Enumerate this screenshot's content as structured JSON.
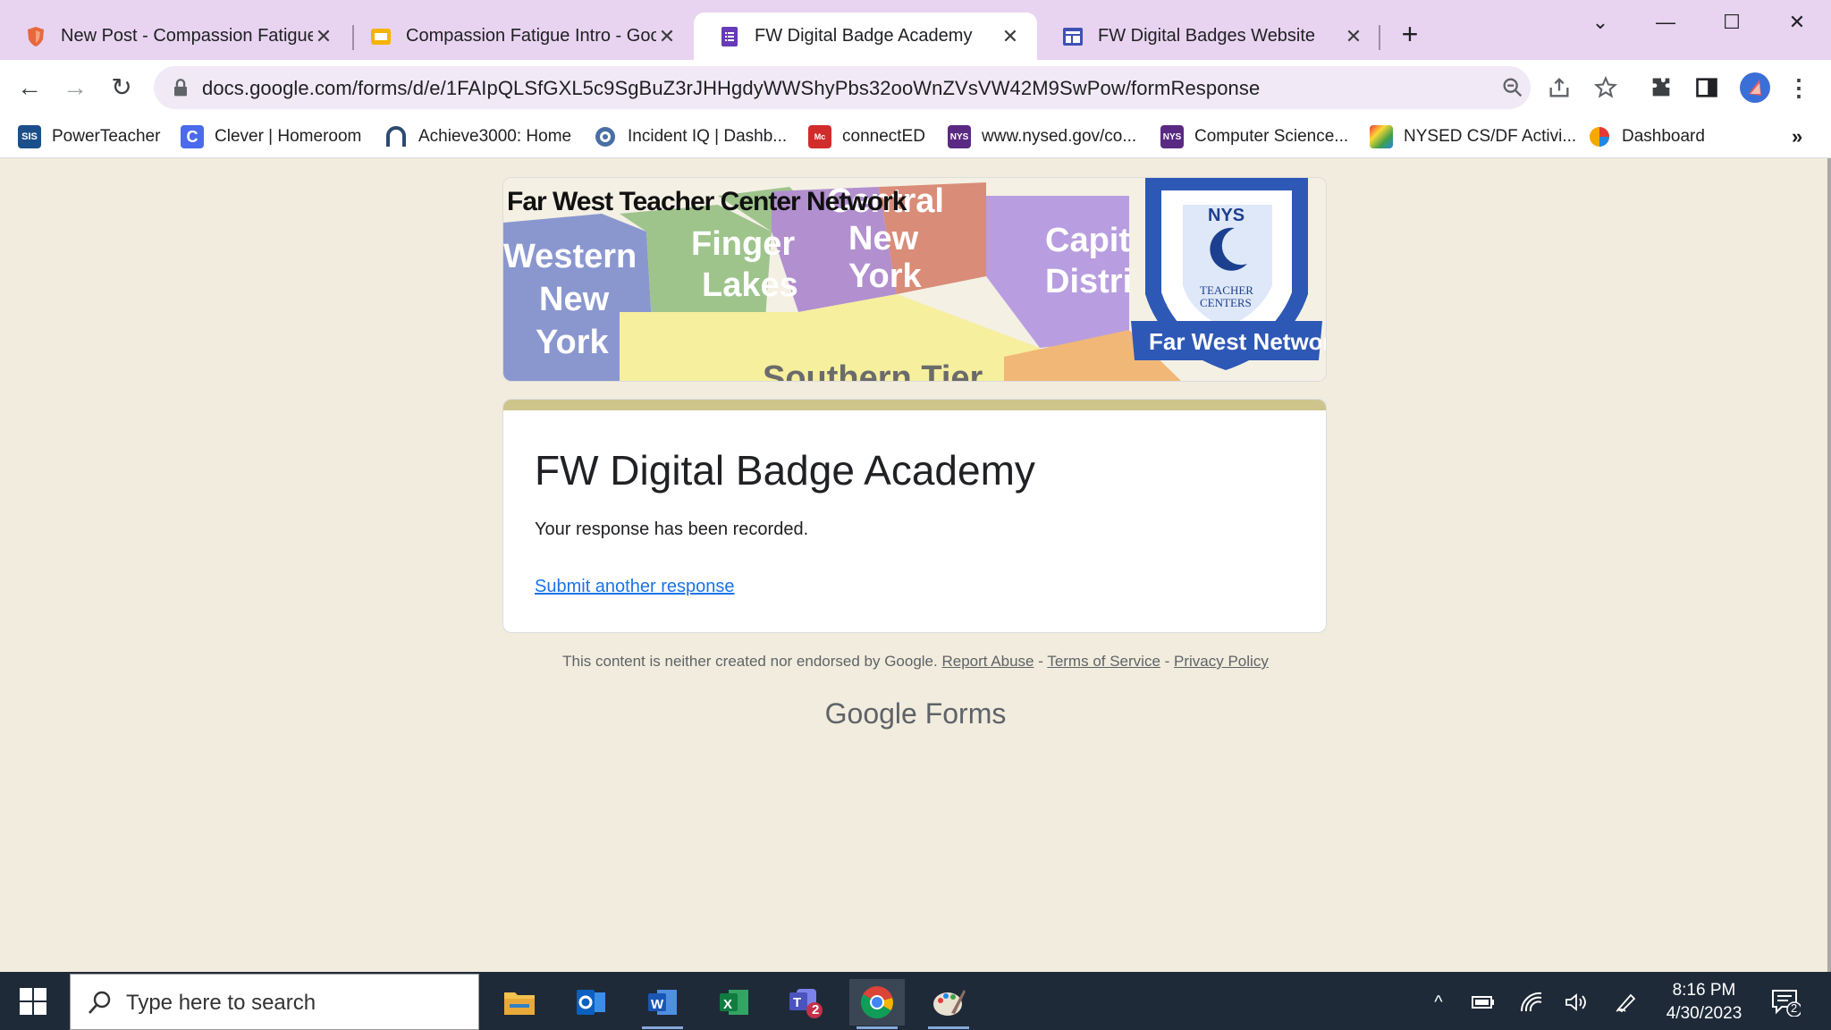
{
  "browser": {
    "tabs": [
      {
        "title": "New Post - Compassion Fatigue",
        "icon": "brave-shield-icon",
        "active": false
      },
      {
        "title": "Compassion Fatigue Intro - Google Slides",
        "icon": "google-slides-icon",
        "active": false
      },
      {
        "title": "FW Digital Badge Academy",
        "icon": "google-forms-icon",
        "active": true
      },
      {
        "title": "FW Digital Badges Website",
        "icon": "google-sites-icon",
        "active": false
      }
    ],
    "new_tab_label": "+",
    "url": "docs.google.com/forms/d/e/1FAIpQLSfGXL5c9SgBuZ3rJHHgdyWWShyPbs32ooWnZVsVW42M9SwPow/formResponse",
    "bookmarks": [
      {
        "label": "PowerTeacher",
        "icon": "sis-icon"
      },
      {
        "label": "Clever | Homeroom",
        "icon": "clever-icon"
      },
      {
        "label": "Achieve3000: Home",
        "icon": "achieve-icon"
      },
      {
        "label": "Incident IQ | Dashb...",
        "icon": "incident-iq-icon"
      },
      {
        "label": "connectED",
        "icon": "mcgraw-hill-icon"
      },
      {
        "label": "www.nysed.gov/co...",
        "icon": "nys-icon"
      },
      {
        "label": "Computer Science...",
        "icon": "nys-icon"
      },
      {
        "label": "NYSED CS/DF Activi...",
        "icon": "nysed-activity-icon"
      },
      {
        "label": "Dashboard",
        "icon": "dashboard-icon"
      }
    ],
    "bookmarks_more": "»"
  },
  "banner": {
    "heading": "Far West Teacher Center Network",
    "regions": [
      "Western",
      "New",
      "York",
      "Finger",
      "Lakes",
      "Central",
      "New",
      "York",
      "Capit",
      "Distri",
      "Southern Tier"
    ],
    "logo_top": "NYS",
    "logo_mid1": "TEACHER",
    "logo_mid2": "CENTERS",
    "logo_ribbon": "Far West Network"
  },
  "form": {
    "title": "FW Digital Badge Academy",
    "message": "Your response has been recorded.",
    "another_link": "Submit another response",
    "accent_color": "#cdc58c"
  },
  "footer": {
    "disclaimer": "This content is neither created nor endorsed by Google.",
    "report_abuse": "Report Abuse",
    "sep1": " - ",
    "terms": "Terms of Service",
    "sep2": " - ",
    "privacy": "Privacy Policy",
    "brand_google": "Google",
    "brand_forms": "Forms"
  },
  "taskbar": {
    "search_placeholder": "Type here to search",
    "teams_badge": "2",
    "time": "8:16 PM",
    "date": "4/30/2023",
    "notification_count": "2"
  }
}
